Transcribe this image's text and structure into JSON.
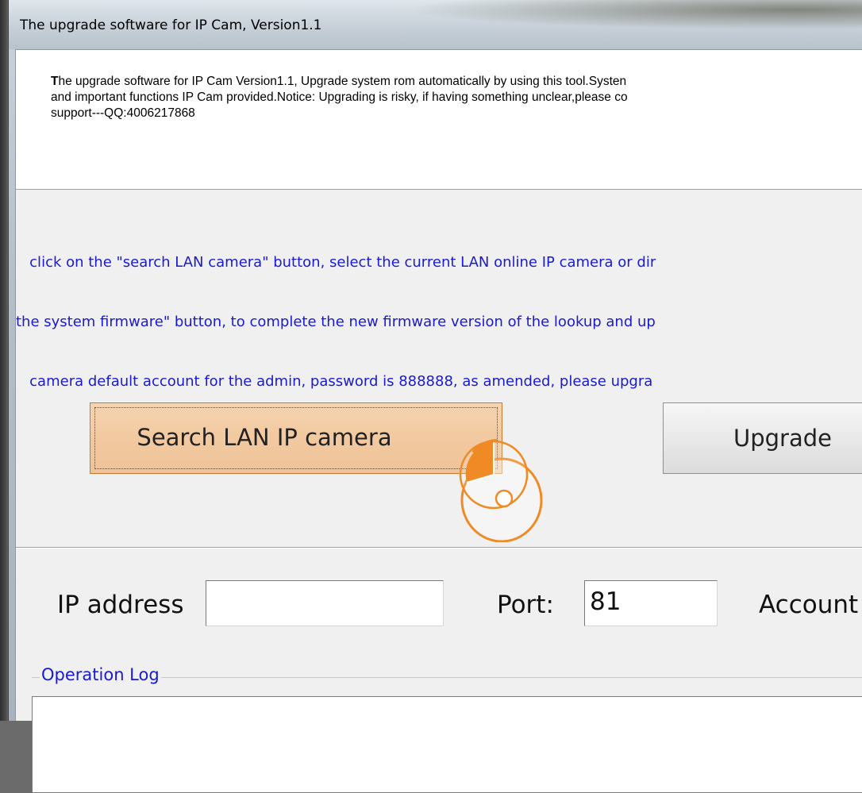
{
  "window": {
    "title": "The upgrade software for IP Cam, Version1.1"
  },
  "notice": {
    "line1": "The upgrade software for IP Cam Version1.1, Upgrade system rom automatically by using this tool.Systen",
    "line2": "and important functions IP Cam provided.Notice: Upgrading is risky, if having something unclear,please co",
    "line3": "support---QQ:4006217868"
  },
  "instructions": {
    "line1": "   click on the \"search LAN camera\" button, select the current LAN online IP camera or dir",
    "line2": "the system firmware\" button, to complete the new firmware version of the lookup and up",
    "line3": "   camera default account for the admin, password is 888888, as amended, please upgra"
  },
  "buttons": {
    "search_label": "Search LAN IP camera",
    "upgrade_label": "Upgrade"
  },
  "form": {
    "ip_label": "IP address",
    "ip_value": "",
    "port_label": "Port:",
    "port_value": "81",
    "account_label": "Account"
  },
  "log": {
    "legend": "Operation Log"
  },
  "colors": {
    "instruction_text": "#1a1ad2",
    "search_button_bg": "#f2c9a0",
    "cursor_orange": "#f08a24"
  },
  "icons": {
    "cursor": "busy-cursor-icon"
  }
}
